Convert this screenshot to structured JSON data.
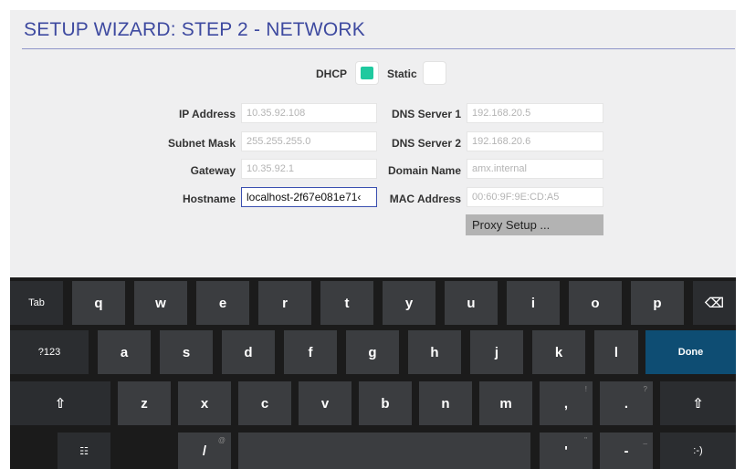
{
  "title": "SETUP WIZARD: STEP 2 - NETWORK",
  "mode": {
    "dhcp_label": "DHCP",
    "static_label": "Static",
    "selected": "DHCP",
    "selected_color": "#1fc99f"
  },
  "fields": {
    "ip_address": {
      "label": "IP Address",
      "value": "10.35.92.108"
    },
    "subnet_mask": {
      "label": "Subnet Mask",
      "value": "255.255.255.0"
    },
    "gateway": {
      "label": "Gateway",
      "value": "10.35.92.1"
    },
    "hostname": {
      "label": "Hostname",
      "value": "localhost-2f67e081e71‹"
    },
    "dns_server_1": {
      "label": "DNS Server 1",
      "value": "192.168.20.5"
    },
    "dns_server_2": {
      "label": "DNS Server 2",
      "value": "192.168.20.6"
    },
    "domain_name": {
      "label": "Domain Name",
      "value": "amx.internal"
    },
    "mac_address": {
      "label": "MAC Address",
      "value": "00:60:9F:9E:CD:A5"
    }
  },
  "proxy_button": "Proxy Setup ...",
  "keyboard": {
    "row1": [
      "Tab",
      "q",
      "w",
      "e",
      "r",
      "t",
      "y",
      "u",
      "i",
      "o",
      "p",
      "⌫"
    ],
    "row2": [
      "?123",
      "a",
      "s",
      "d",
      "f",
      "g",
      "h",
      "j",
      "k",
      "l",
      "Done"
    ],
    "row3": [
      "⇧",
      "z",
      "x",
      "c",
      "v",
      "b",
      "n",
      "m",
      ",",
      ".",
      "⇧"
    ],
    "row3_hints": [
      "!",
      "?"
    ],
    "row4": [
      "☷",
      "/",
      "'",
      "-",
      ":-)"
    ],
    "row4_hints": [
      "@",
      "\"",
      "_"
    ],
    "done_color": "#0e4d73"
  }
}
